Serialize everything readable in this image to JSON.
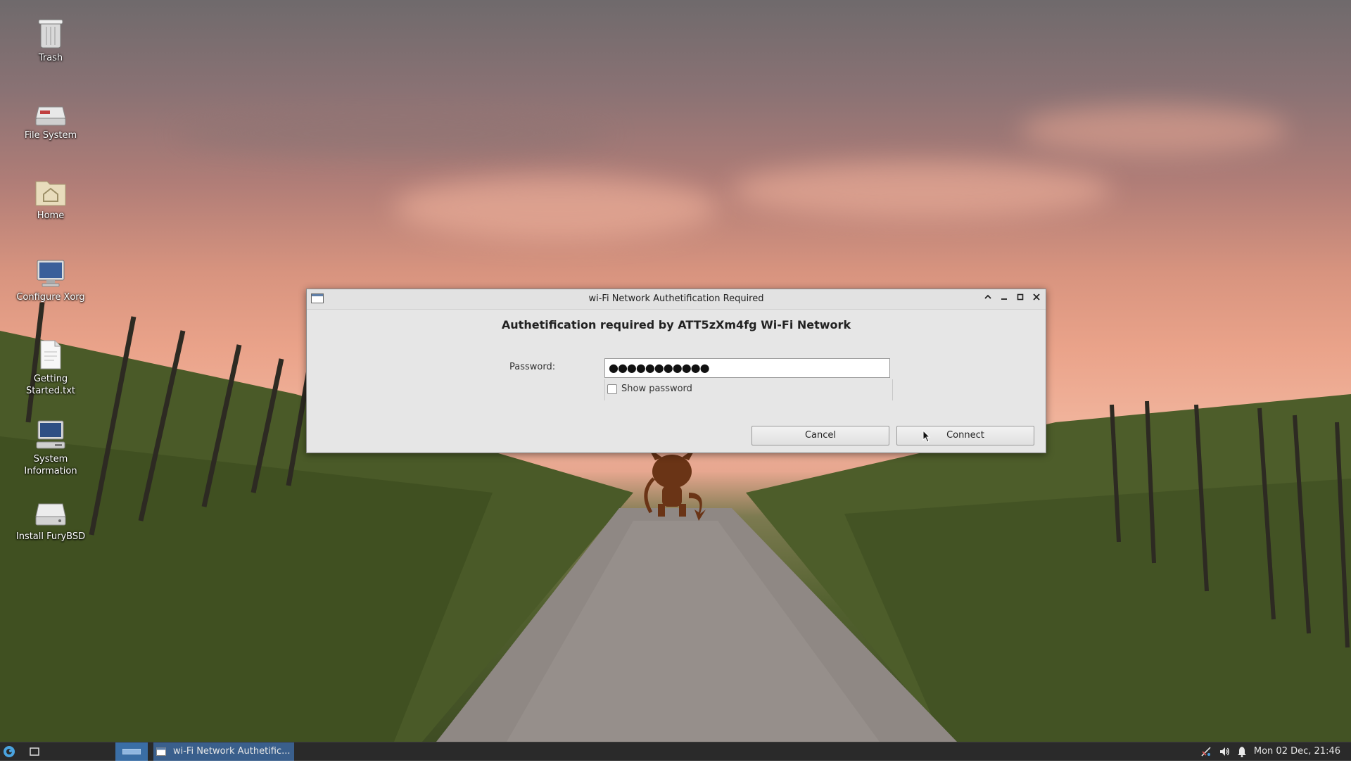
{
  "desktop": {
    "icons": [
      {
        "label": "Trash",
        "icon": "trash-icon"
      },
      {
        "label": "File System",
        "icon": "drive-icon"
      },
      {
        "label": "Home",
        "icon": "home-folder-icon"
      },
      {
        "label": "Configure Xorg",
        "icon": "monitor-icon"
      },
      {
        "label": "Getting Started.txt",
        "icon": "text-file-icon"
      },
      {
        "label": "System Information",
        "icon": "computer-icon"
      },
      {
        "label": "Install FuryBSD",
        "icon": "disk-drive-icon"
      }
    ]
  },
  "dialog": {
    "window_title": "wi-Fi Network Authetification Required",
    "heading": "Authetification required by ATT5zXm4fg Wi-Fi Network",
    "password_label": "Password:",
    "password_value": "●●●●●●●●●●●",
    "show_password_label": "Show password",
    "show_password_checked": false,
    "cancel_label": "Cancel",
    "connect_label": "Connect"
  },
  "taskbar": {
    "task_label": "wi-Fi Network Authetific...",
    "clock": "Mon 02 Dec, 21:46"
  },
  "colors": {
    "taskbar_bg": "#2a2a2a",
    "active_task": "#3a5f8c",
    "dialog_bg": "#e6e6e6"
  }
}
